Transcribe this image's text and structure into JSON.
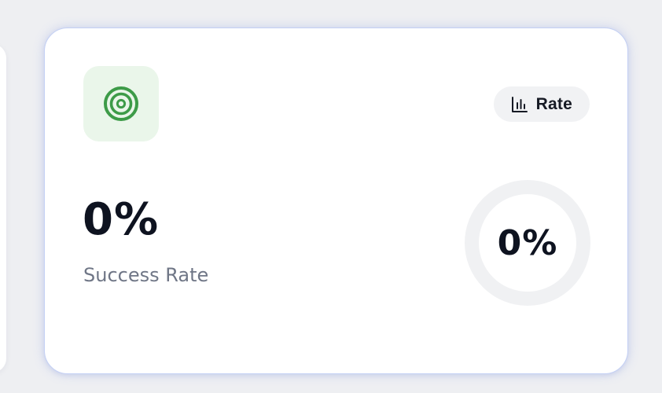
{
  "card": {
    "icon": "target-icon",
    "accent_color": "#3d9b48",
    "icon_tile_bg": "#eaf6ea",
    "badge": {
      "icon": "bar-chart-icon",
      "label": "Rate"
    },
    "metric": {
      "value": "0%",
      "label": "Success Rate"
    },
    "gauge": {
      "text": "0%",
      "progress": 0,
      "track_color": "#f0f1f3"
    }
  }
}
